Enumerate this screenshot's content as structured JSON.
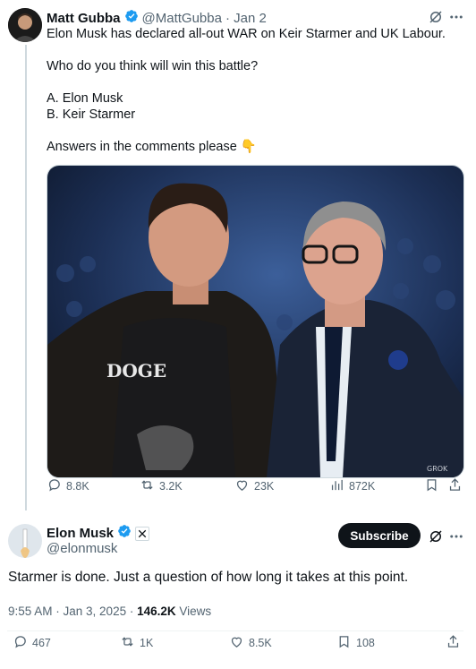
{
  "tweet1": {
    "name": "Matt Gubba",
    "handle": "@MattGubba",
    "date": "· Jan 2",
    "text": "Elon Musk has declared all-out WAR on Keir Starmer and UK Labour.\n\nWho do you think will win this battle?\n\nA. Elon Musk\nB. Keir Starmer\n\nAnswers in the comments please 👇",
    "image_watermark": "GROK",
    "shirt_text": "DOGE",
    "stats": {
      "replies": "8.8K",
      "reposts": "3.2K",
      "likes": "23K",
      "views": "872K"
    }
  },
  "tweet2": {
    "name": "Elon Musk",
    "handle": "@elonmusk",
    "subscribe_label": "Subscribe",
    "text": "Starmer is done. Just a question of how long it takes at this point.",
    "timestamp": "9:55 AM · Jan 3, 2025 · ",
    "views_count": "146.2K",
    "views_label": " Views",
    "stats": {
      "replies": "467",
      "reposts": "1K",
      "likes": "8.5K",
      "bookmarks": "108"
    }
  },
  "colors": {
    "verified": "#1d9bf0",
    "muted": "#536471",
    "text": "#0f1419"
  },
  "icons": [
    "grok-icon",
    "more-icon",
    "reply-icon",
    "repost-icon",
    "like-icon",
    "views-icon",
    "bookmark-icon",
    "share-icon",
    "verified-icon",
    "x-affiliate-icon"
  ]
}
